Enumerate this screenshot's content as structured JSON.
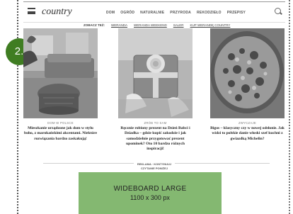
{
  "step_badge": "2.",
  "header": {
    "logo": "country",
    "nav": [
      "DOM",
      "OGRÓD",
      "NATURALNIE",
      "PRZYRODA",
      "REKODZIEŁO",
      "PRZEPISY"
    ]
  },
  "see_also": {
    "label": "ZOBACZ TEŻ:",
    "links": [
      "WERANDA",
      "WERANDA WEEKEND",
      "SALER",
      "KUP WERANDĘ COUNTRY"
    ]
  },
  "cards": [
    {
      "category": "DOM W POLSCE",
      "title": "Mieszkanie urządzone jak dom w stylu boho, z marokańskimi akcentami. Niektóre rozwiązania bardzo zaskakują!"
    },
    {
      "category": "ZRÓB TO SAM",
      "title": "Ręcznie robiony prezent na Dzień Babci i Dziadka – gdzie kupić zakodzie i jak samodzielnie przygotować prezent upominek? Oto 10 bardzo różnych inspiracji!"
    },
    {
      "category": "ZWYCZAJE",
      "title": "Bigos – klasyczny czy w nowej odsłonie. Jak widzi to polskie danie włoski szef kuchni z gwiazdką Michelin?"
    }
  ],
  "ad": {
    "label_line1": "REKLAMA · KONTYNUUJ",
    "label_line2": "CZYTANIE PONIŻEJ",
    "box_line1": "WIDEBOARD LARGE",
    "box_line2": "1100 x 300 px",
    "box_color": "#84b871"
  }
}
